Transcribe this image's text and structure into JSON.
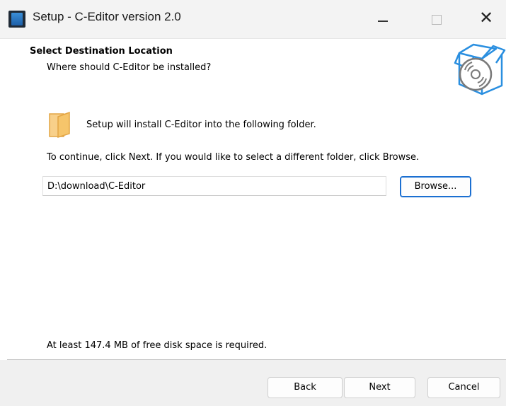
{
  "window": {
    "title": "Setup - C-Editor version 2.0",
    "controls": {
      "minimize": "—",
      "maximize": "☐",
      "close": "✕"
    }
  },
  "page": {
    "heading": "Select Destination Location",
    "subheading": "Where should C-Editor be installed?",
    "folder_message": "Setup will install C-Editor into the following folder.",
    "instruction": "To continue, click Next. If you would like to select a different folder, click Browse.",
    "install_path": "D:\\download\\C-Editor",
    "browse_label": "Browse...",
    "disk_space_note": "At least 147.4 MB of free disk space is required."
  },
  "footer": {
    "back_label": "Back",
    "next_label": "Next",
    "cancel_label": "Cancel"
  },
  "icons": {
    "app": "installer-app-icon",
    "header": "open-box-with-disc-icon",
    "folder": "folder-icon"
  },
  "colors": {
    "accent": "#1b6fd1",
    "icon_blue": "#2a8fe0",
    "folder": "#f6c56b"
  }
}
